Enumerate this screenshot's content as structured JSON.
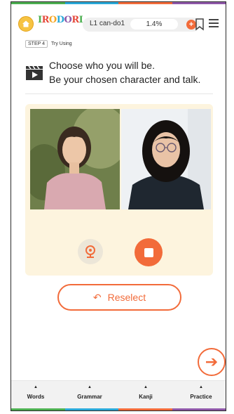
{
  "colors": {
    "accent": "#f26b3a",
    "panel": "#fdf4de",
    "stripe": [
      "#4caf50",
      "#29a8d8",
      "#f26b3a",
      "#8e57a8"
    ]
  },
  "header": {
    "home_label": "HOME",
    "logo": "IRODORI",
    "lesson": "L1 can-do1",
    "progress": "1.4%",
    "progress_value": 1.4,
    "plus": "+"
  },
  "step": {
    "badge": "STEP 4",
    "label": "Try Using"
  },
  "instruction": {
    "line1": "Choose who you will be.",
    "line2": "Be your chosen character and talk."
  },
  "actions": {
    "reselect": "Reselect"
  },
  "nav": {
    "items": [
      {
        "label": "Words"
      },
      {
        "label": "Grammar"
      },
      {
        "label": "Kanji"
      },
      {
        "label": "Practice"
      }
    ]
  }
}
